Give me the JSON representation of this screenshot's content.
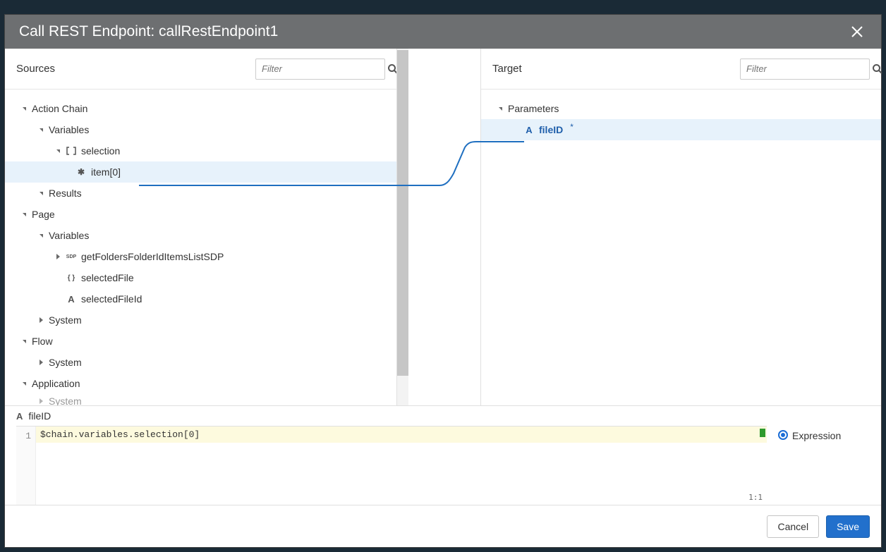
{
  "dialog": {
    "title": "Call REST Endpoint: callRestEndpoint1"
  },
  "sources": {
    "heading": "Sources",
    "filter_placeholder": "Filter",
    "tree": {
      "action_chain": "Action Chain",
      "variables": "Variables",
      "selection": "selection",
      "item0": "item[0]",
      "results": "Results",
      "page": "Page",
      "page_variables": "Variables",
      "getFolders": "getFoldersFolderIdItemsListSDP",
      "selectedFile": "selectedFile",
      "selectedFileId": "selectedFileId",
      "system": "System",
      "flow": "Flow",
      "flow_system": "System",
      "application": "Application",
      "app_system": "System"
    }
  },
  "target": {
    "heading": "Target",
    "filter_placeholder": "Filter",
    "tree": {
      "parameters": "Parameters",
      "fileID": "fileID"
    }
  },
  "editor": {
    "param_name": "fileID",
    "line_number": "1",
    "code": "$chain.variables.selection[0]",
    "cursor_pos": "1:1",
    "expression_label": "Expression"
  },
  "footer": {
    "cancel": "Cancel",
    "save": "Save"
  }
}
